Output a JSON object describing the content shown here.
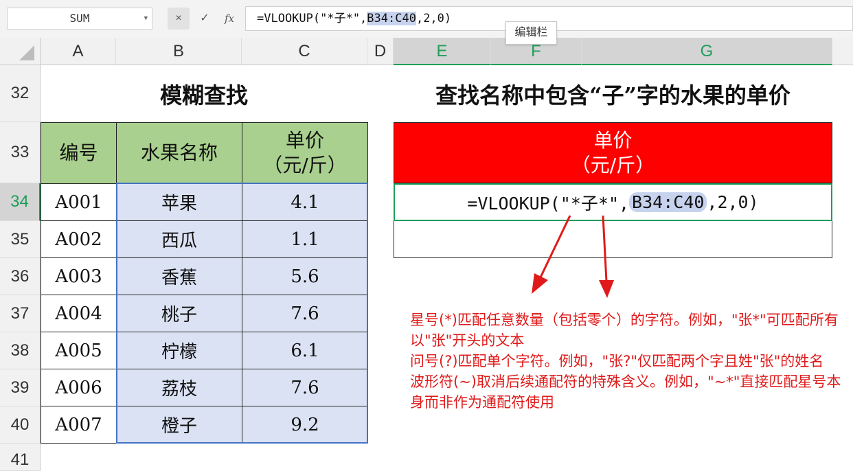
{
  "formula_bar": {
    "name_box": "SUM",
    "cancel_icon": "×",
    "confirm_icon": "✓",
    "fx_label": "fx",
    "formula_prefix": "=VLOOKUP(\"*子*\",",
    "formula_ref": "B34:C40",
    "formula_suffix": ",2,0)",
    "tooltip": "编辑栏"
  },
  "columns": [
    "A",
    "B",
    "C",
    "D",
    "E",
    "F",
    "G"
  ],
  "rows": [
    "32",
    "33",
    "34",
    "35",
    "36",
    "37",
    "38",
    "39",
    "40",
    "41"
  ],
  "left_table": {
    "title": "模糊查找",
    "headers": {
      "id": "编号",
      "name": "水果名称",
      "price_line1": "单价",
      "price_line2": "（元/斤）"
    },
    "rows": [
      {
        "id": "A001",
        "name": "苹果",
        "price": "4.1"
      },
      {
        "id": "A002",
        "name": "西瓜",
        "price": "1.1"
      },
      {
        "id": "A003",
        "name": "香蕉",
        "price": "5.6"
      },
      {
        "id": "A004",
        "name": "桃子",
        "price": "7.6"
      },
      {
        "id": "A005",
        "name": "柠檬",
        "price": "6.1"
      },
      {
        "id": "A006",
        "name": "荔枝",
        "price": "7.6"
      },
      {
        "id": "A007",
        "name": "橙子",
        "price": "9.2"
      }
    ]
  },
  "right_table": {
    "title": "查找名称中包含“子”字的水果的单价",
    "header_line1": "单价",
    "header_line2": "（元/斤）",
    "formula_prefix": "=VLOOKUP(\"*子*\",",
    "formula_ref": "B34:C40",
    "formula_suffix": ",2,0)"
  },
  "notes": [
    "星号(*)匹配任意数量（包括零个）的字符。例如，\"张*\"可匹配所有以\"张\"开头的文本",
    "问号(?)匹配单个字符。例如，\"张?\"仅匹配两个字且姓\"张\"的姓名",
    "波形符(~)取消后续通配符的特殊含义。例如，\"~*\"直接匹配星号本身而非作为通配符使用"
  ],
  "colors": {
    "header_green": "#a9d08e",
    "red_header": "#ff0000",
    "note_red": "#e01a1a",
    "selection_blue": "#dbe2f4",
    "active_green": "#1f9e5a"
  },
  "icons": [
    "cancel-icon",
    "confirm-icon",
    "fx-icon",
    "dropdown-arrow-icon",
    "select-all-icon",
    "arrow-annotation"
  ]
}
